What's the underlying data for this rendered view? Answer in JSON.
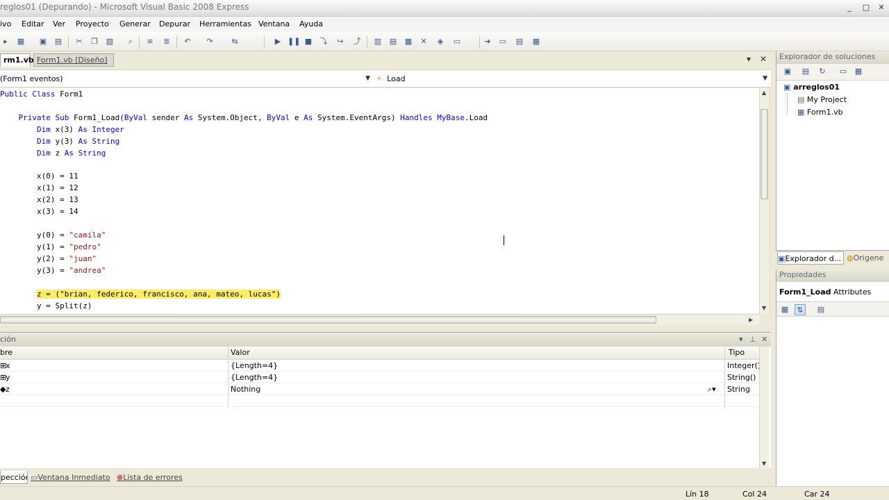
{
  "window": {
    "title": "reglos01 (Depurando) - Microsoft Visual Basic 2008 Express",
    "min": "_",
    "max": "□",
    "close": "✕"
  },
  "menu": [
    "ivo",
    "Editar",
    "Ver",
    "Proyecto",
    "Generar",
    "Depurar",
    "Herramientas",
    "Ventana",
    "Ayuda"
  ],
  "doc_tabs": {
    "active": "rm1.vb",
    "inactive": "Form1.vb [Diseño]"
  },
  "combos": {
    "left": "(Form1 eventos)",
    "right_icon": "⚡",
    "right": "Load"
  },
  "code": {
    "l1": {
      "kw1": "Public Class",
      "rest": " Form1"
    },
    "l2": {
      "indent": "    ",
      "kw1": "Private Sub",
      "t1": " Form1_Load(",
      "kw2": "ByVal",
      "t2": " sender ",
      "kw3": "As",
      "t3": " System.Object, ",
      "kw4": "ByVal",
      "t4": " e ",
      "kw5": "As",
      "t5": " System.EventArgs) ",
      "kw6": "Handles",
      "t6": " ",
      "kw7": "MyBase",
      "t7": ".Load"
    },
    "l3": {
      "indent": "        ",
      "kw1": "Dim",
      "t1": " x(3) ",
      "kw2": "As Integer"
    },
    "l4": {
      "indent": "        ",
      "kw1": "Dim",
      "t1": " y(3) ",
      "kw2": "As String"
    },
    "l5": {
      "indent": "        ",
      "kw1": "Dim",
      "t1": " z ",
      "kw2": "As String"
    },
    "l6": "        x(0) = 11",
    "l7": "        x(1) = 12",
    "l8": "        x(2) = 13",
    "l9": "        x(3) = 14",
    "l10": {
      "indent": "        ",
      "t": "y(0) = ",
      "s": "\"camila\""
    },
    "l11": {
      "indent": "        ",
      "t": "y(1) = ",
      "s": "\"pedro\""
    },
    "l12": {
      "indent": "        ",
      "t": "y(2) = ",
      "s": "\"juan\""
    },
    "l13": {
      "indent": "        ",
      "t": "y(3) = ",
      "s": "\"andrea\""
    },
    "l14": {
      "indent": "        ",
      "hl": "z = (\"brian, federico, francisco, ana, mateo, lucas\")"
    },
    "l15": "        y = Split(z)",
    "current_line_color": "#ffee62"
  },
  "solution_explorer": {
    "title": "Explorador de soluciones",
    "project": "arreglos01",
    "items": [
      "My Project",
      "Form1.vb"
    ],
    "tab1": "Explorador d...",
    "tab2": "Origene"
  },
  "properties": {
    "title": "Propiedades",
    "selected_name": "Form1_Load",
    "selected_type": "Attributes"
  },
  "watch": {
    "title": "ción",
    "columns": {
      "name": "bre",
      "value": "Valor",
      "type": "Tipo"
    },
    "rows": [
      {
        "name": "x",
        "value": "{Length=4}",
        "type": "Integer()"
      },
      {
        "name": "y",
        "value": "{Length=4}",
        "type": "String()"
      },
      {
        "name": "z",
        "value": "Nothing",
        "type": "String"
      }
    ]
  },
  "bottom_tabs": [
    "pección",
    "Ventana Inmediato",
    "Lista de errores"
  ],
  "status": {
    "line": "Lín 18",
    "col": "Col 24",
    "char": "Car 24"
  }
}
